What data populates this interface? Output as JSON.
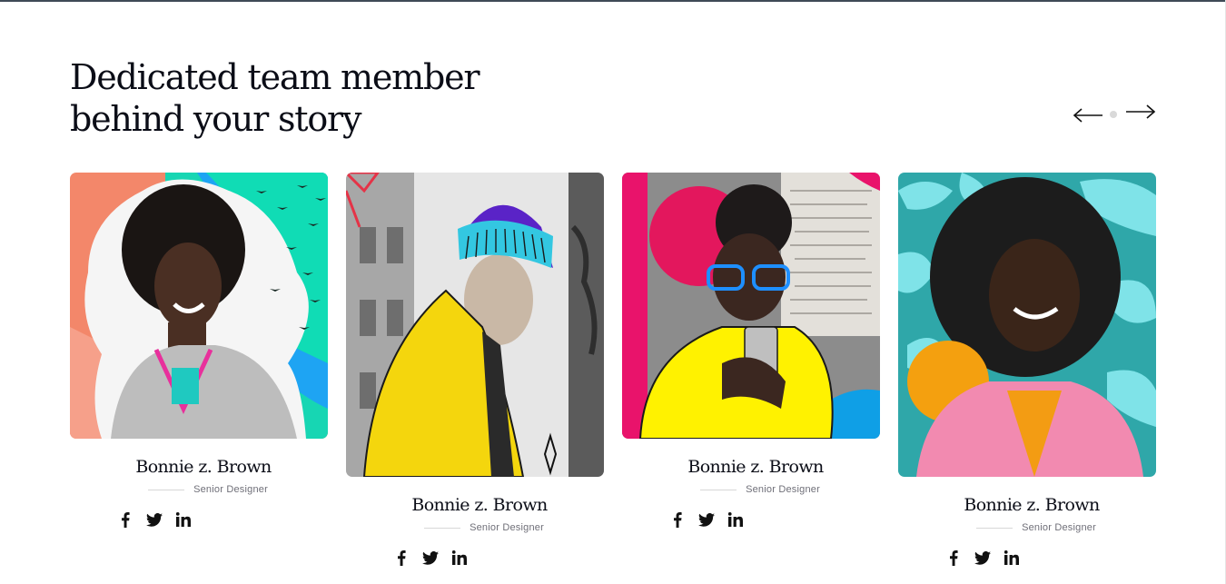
{
  "section": {
    "title_line1": "Dedicated team member",
    "title_line2": "behind your story"
  },
  "carousel": {
    "prev_icon": "arrow-left-icon",
    "next_icon": "arrow-right-icon"
  },
  "team": [
    {
      "name": "Bonnie z. Brown",
      "role": "Senior Designer"
    },
    {
      "name": "Bonnie z. Brown",
      "role": "Senior Designer"
    },
    {
      "name": "Bonnie z. Brown",
      "role": "Senior Designer"
    },
    {
      "name": "Bonnie z. Brown",
      "role": "Senior Designer"
    }
  ],
  "social_icons": [
    "facebook-icon",
    "twitter-icon",
    "linkedin-icon"
  ],
  "colors": {
    "heading": "#0b0d17",
    "muted": "#6f6f78"
  }
}
